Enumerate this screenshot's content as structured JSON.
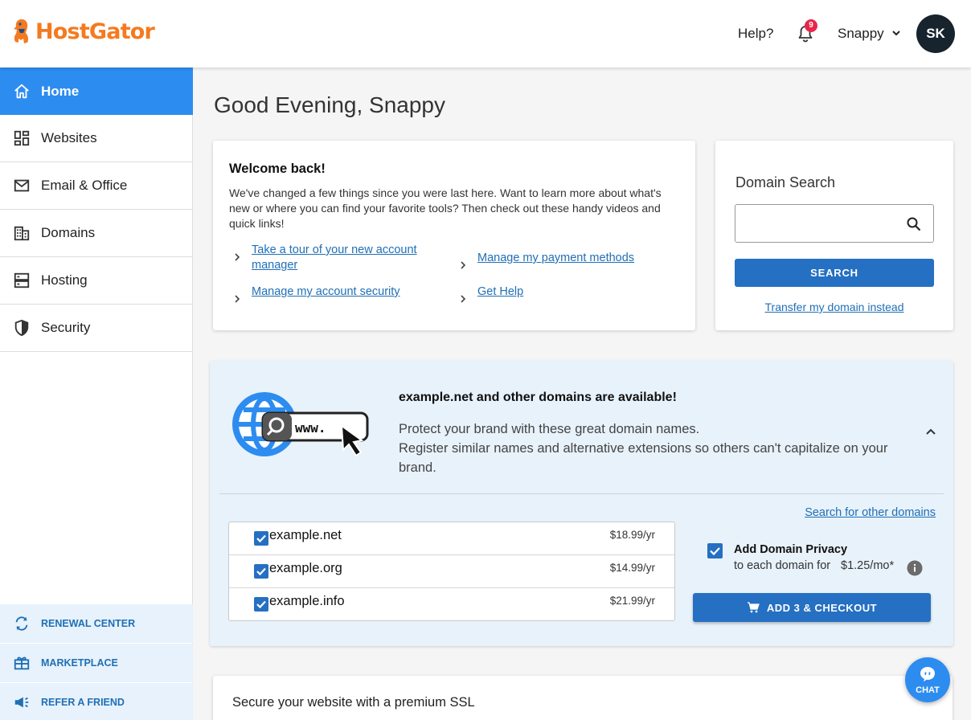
{
  "brand": {
    "name": "HostGator",
    "accent": "#f47a20",
    "primary": "#2570c2",
    "active_nav": "#2d8cf0"
  },
  "header": {
    "help": "Help?",
    "notifications_count": "9",
    "user_name": "Snappy",
    "avatar_initials": "SK"
  },
  "sidebar": {
    "items": [
      {
        "label": "Home",
        "icon": "home-icon",
        "active": true
      },
      {
        "label": "Websites",
        "icon": "dashboard-icon"
      },
      {
        "label": "Email & Office",
        "icon": "mail-icon"
      },
      {
        "label": "Domains",
        "icon": "building-icon"
      },
      {
        "label": "Hosting",
        "icon": "server-icon"
      },
      {
        "label": "Security",
        "icon": "shield-icon"
      }
    ],
    "bottom": [
      {
        "label": "RENEWAL CENTER",
        "icon": "refresh-icon"
      },
      {
        "label": "MARKETPLACE",
        "icon": "gift-icon"
      },
      {
        "label": "REFER A FRIEND",
        "icon": "megaphone-icon"
      }
    ]
  },
  "main": {
    "greeting": "Good Evening, Snappy",
    "welcome": {
      "title": "Welcome back!",
      "body": "We've changed a few things since you were last here. Want to learn more about what's new or where you can find your favorite tools? Then check out these handy videos and quick links!",
      "links": [
        "Take a tour of your new account manager",
        "Manage my payment methods",
        "Manage my account security",
        "Get Help"
      ]
    },
    "domain_search": {
      "title": "Domain Search",
      "input_value": "",
      "button": "SEARCH",
      "transfer_link": "Transfer my domain instead"
    },
    "promo": {
      "illustration_text": "www.",
      "title": "example.net and other domains are available!",
      "line1": "Protect your brand with these great domain names.",
      "line2": "Register similar names and alternative extensions so others can't capitalize on your brand.",
      "search_other": "Search for other domains",
      "domains": [
        {
          "name": "example.net",
          "price": "$18.99/yr",
          "checked": true
        },
        {
          "name": "example.org",
          "price": "$14.99/yr",
          "checked": true
        },
        {
          "name": "example.info",
          "price": "$21.99/yr",
          "checked": true
        }
      ],
      "privacy": {
        "checked": true,
        "title": "Add Domain Privacy",
        "subtitle": "to each domain for",
        "price": "$1.25/mo*"
      },
      "checkout_button": "ADD 3 & CHECKOUT"
    },
    "ssl": {
      "title": "Secure your website with a premium SSL"
    }
  },
  "chat": {
    "label": "CHAT"
  }
}
